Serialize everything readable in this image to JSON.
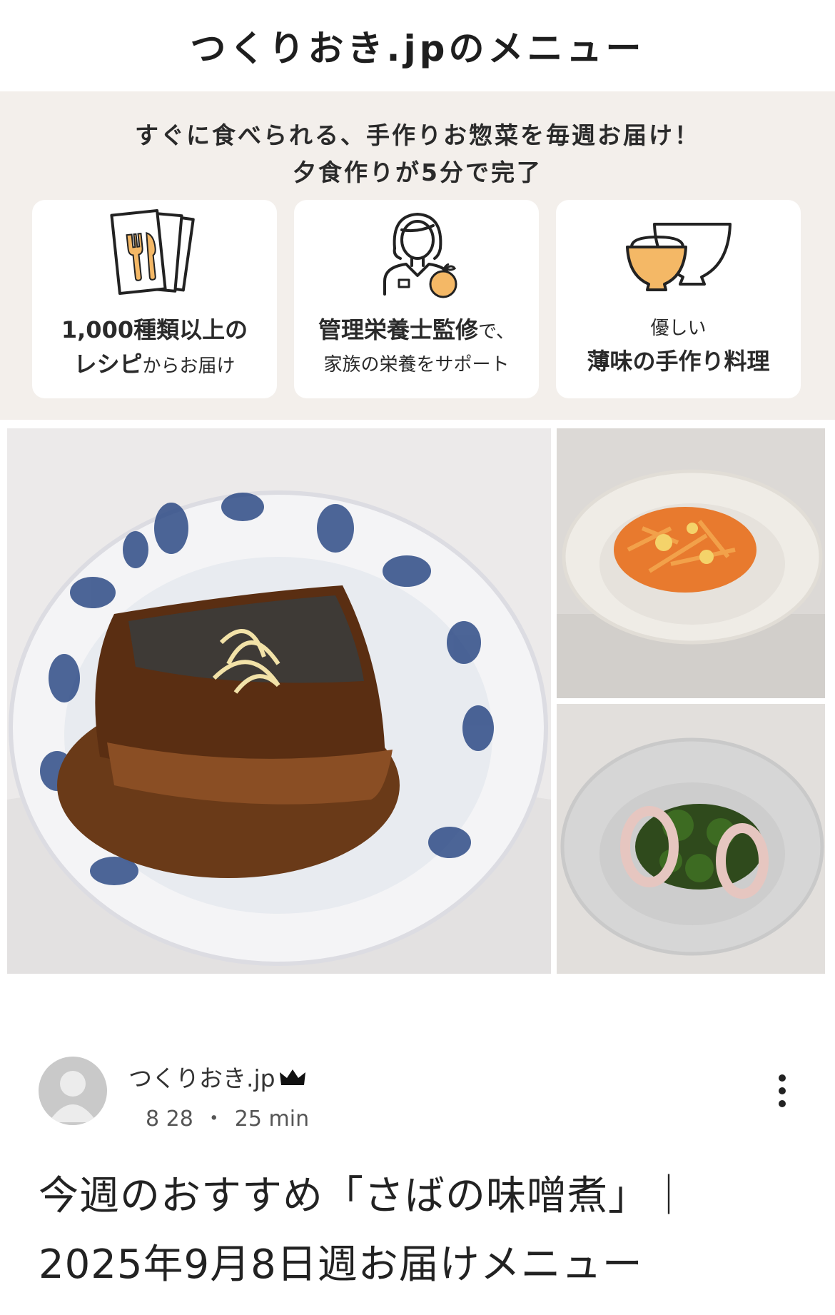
{
  "banner": {
    "title": "つくりおき.jpのメニュー",
    "headline_line1": "すぐに食べられる、手作りお惣菜を毎週お届け！",
    "headline_line2": "夕食作りが5分で完了",
    "cards": [
      {
        "icon": "menu-cards-icon",
        "line1_bold": "1,000種類以上の",
        "line2_bold": "レシピ",
        "line2_small": "からお届け"
      },
      {
        "icon": "nutritionist-icon",
        "line1_bold": "管理栄養士監修",
        "line1_small": "で、",
        "line2_small": "家族の栄養をサポート"
      },
      {
        "icon": "bowls-icon",
        "line1_small": "優しい",
        "line2_bold": "薄味の手作り料理"
      }
    ],
    "accent_color": "#f4b866"
  },
  "photos": [
    {
      "name": "saba-miso-photo"
    },
    {
      "name": "carrot-salad-photo"
    },
    {
      "name": "squid-broccoli-photo"
    }
  ],
  "post": {
    "author": "つくりおき.jp",
    "date": "8 28",
    "separator": "・",
    "read_time": "25 min",
    "title_line1": "今週のおすすめ「さばの味噌煮」｜",
    "title_line2": "2025年9月8日週お届けメニュー"
  }
}
